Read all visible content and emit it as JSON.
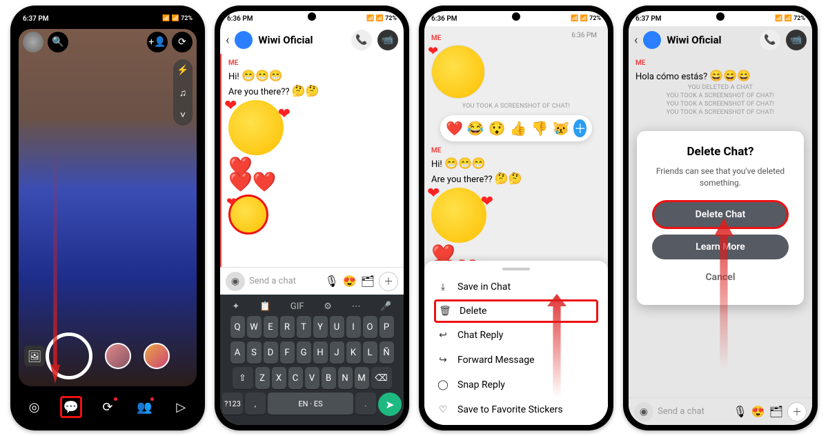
{
  "status": {
    "time_a": "6:37 PM",
    "time_b": "6:36 PM",
    "icons_text": "📶 📶 72%"
  },
  "contact_name": "Wiwi Oficial",
  "s2": {
    "me": "ME",
    "msg1": "Hi!",
    "msg1_emoji": "😁😁😁",
    "msg2": "Are you there??",
    "msg2_emoji": "🤔🤔",
    "placeholder": "Send a chat",
    "kb_rows": {
      "r1": [
        "Q",
        "W",
        "E",
        "R",
        "T",
        "Y",
        "U",
        "I",
        "O",
        "P"
      ],
      "r2": [
        "A",
        "S",
        "D",
        "F",
        "G",
        "H",
        "J",
        "K",
        "L",
        "Ñ"
      ],
      "r3": [
        "⇧",
        "Z",
        "X",
        "C",
        "V",
        "B",
        "N",
        "M",
        "⌫"
      ],
      "r4_lang": "EN · ES"
    },
    "kb_toolbar": [
      "✦",
      "📋",
      "GIF",
      "⚙",
      "⋯",
      "🎤"
    ]
  },
  "s3": {
    "me": "ME",
    "time": "6:36 PM",
    "sys": "YOU TOOK A SCREENSHOT OF CHAT!",
    "msg1": "Hi!",
    "msg1_emoji": "😁😁😁",
    "msg2": "Are you there??",
    "msg2_emoji": "🤔🤔",
    "reactions": [
      "❤️",
      "😂",
      "😯",
      "👍",
      "👎",
      "😿"
    ],
    "menu": {
      "save": "Save in Chat",
      "delete": "Delete",
      "reply": "Chat Reply",
      "forward": "Forward Message",
      "snap": "Snap Reply",
      "fav": "Save to Favorite Stickers"
    }
  },
  "s4": {
    "me": "ME",
    "msg": "Hola cómo estás?",
    "msg_emoji": "😄😄😄",
    "sys1": "YOU DELETED A CHAT",
    "sys2": "YOU TOOK A SCREENSHOT OF CHAT!",
    "dialog": {
      "title": "Delete Chat?",
      "body": "Friends can see that you've deleted something.",
      "delete": "Delete Chat",
      "learn": "Learn More",
      "cancel": "Cancel"
    },
    "placeholder": "Send a chat"
  }
}
